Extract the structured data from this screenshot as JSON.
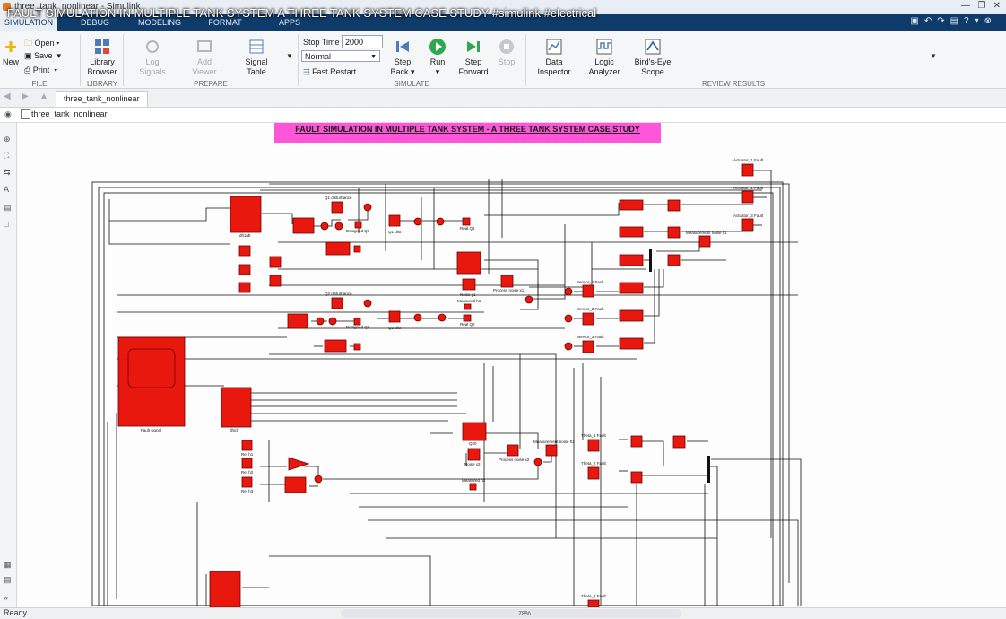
{
  "window": {
    "title": "three_tank_nonlinear - Simulink"
  },
  "overlay_title": "FAULT SIMULATION IN MULTIPLE TANK SYSTEM A THREE TANK SYSTEM CASE STUDY #simulink #electrical",
  "tabs": [
    "SIMULATION",
    "DEBUG",
    "MODELING",
    "FORMAT",
    "APPS"
  ],
  "ribbon": {
    "file": {
      "new": "New",
      "open": "Open",
      "save": "Save",
      "print": "Print",
      "group": "FILE"
    },
    "library": {
      "browser": "Library Browser",
      "group": "LIBRARY"
    },
    "prepare": {
      "log_signals": "Log Signals",
      "add_viewer": "Add Viewer",
      "signal_table": "Signal Table",
      "group": "PREPARE"
    },
    "simulate": {
      "stop_time_label": "Stop Time",
      "stop_time_value": "2000",
      "mode": "Normal",
      "fast_restart": "Fast Restart",
      "step_back": "Step Back",
      "run": "Run",
      "step_forward": "Step Forward",
      "stop": "Stop",
      "group": "SIMULATE"
    },
    "review": {
      "data_inspector": "Data Inspector",
      "logic_analyzer": "Logic Analyzer",
      "birds_eye": "Bird's-Eye Scope",
      "group": "REVIEW RESULTS"
    }
  },
  "model_tab": "three_tank_nonlinear",
  "breadcrumb": "three_tank_nonlinear",
  "banner": "FAULT SIMULATION IN MULTIPLE TANK SYSTEM - A THREE TANK SYSTEM CASE STUDY",
  "labels": {
    "q1_disturbance": "Q1 disturbance",
    "designed_q1": "Designed Q1",
    "q1_dist": "Q1 dist",
    "real_q1": "Real Q1",
    "q2_disturbance": "Q2 disturbance",
    "designed_q2": "Designed Q2",
    "q2_dist": "Q2 dist",
    "real_q2": "Real Q2",
    "noise_y1": "Noise y1",
    "process_noise_x1": "Process noise x1",
    "measured_h1": "Measured h1",
    "sensor1": "Sensor_1 Fault",
    "sensor2": "Sensor_2 Fault",
    "sensor3": "Sensor_3 Fault",
    "act1": "Actuator_1 Fault",
    "act2": "Actuator_2 Fault",
    "act3": "Actuator_3 Fault",
    "meas_noise_x1": "Measurement noise h1",
    "meas_noise_h2": "Measurement noise h2",
    "theta1": "Theta_1 Fault",
    "theta2": "Theta_2 Fault",
    "theta3": "Theta_3 Fault",
    "fault_signal": "Fault signal",
    "ref_h1": "Ref h1",
    "ref_h2": "Ref h2",
    "ref_h3": "Ref h3",
    "d1": "dh1/dt",
    "dtdt": "dh/dt",
    "q20": "Q20",
    "noise_x2": "Noise x2",
    "process_noise_x2": "Process noise x2",
    "measured_h2": "Measured h2"
  },
  "status": "Ready",
  "zoom": "78%"
}
